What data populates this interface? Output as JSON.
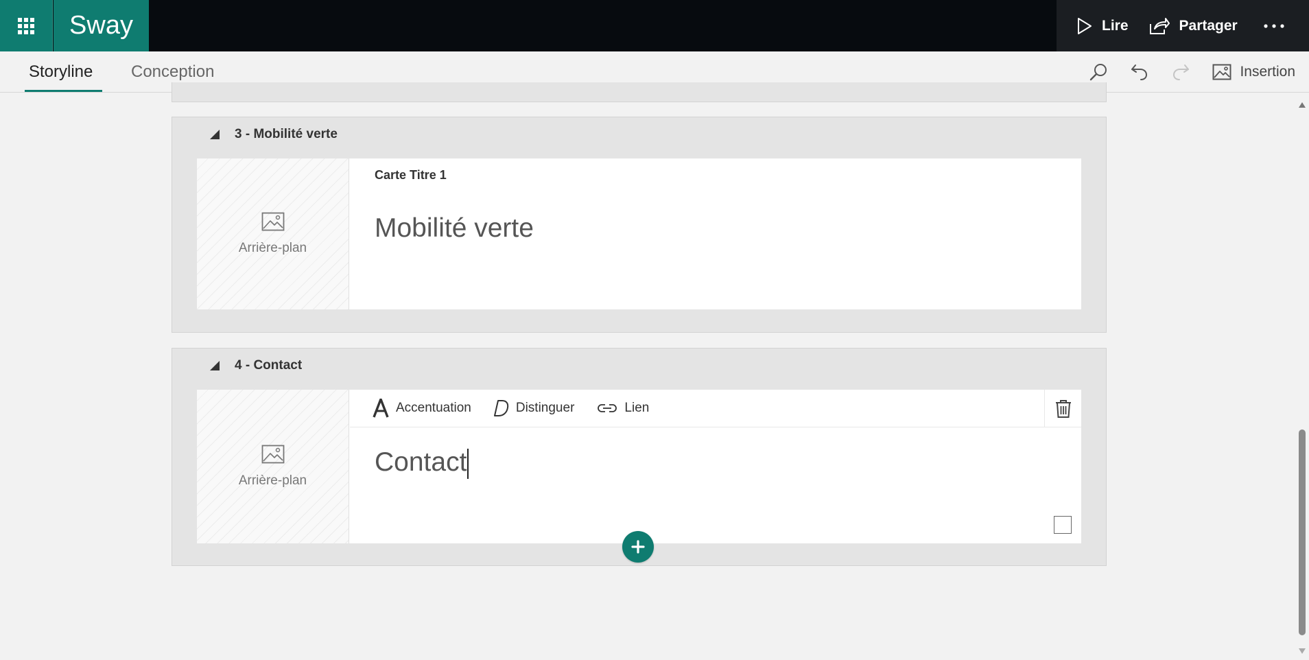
{
  "app": {
    "name": "Sway"
  },
  "topbar": {
    "play_label": "Lire",
    "share_label": "Partager",
    "icons": [
      "waffle-icon",
      "play-icon",
      "share-icon",
      "more-icon"
    ]
  },
  "tabs": [
    {
      "label": "Storyline",
      "active": true
    },
    {
      "label": "Conception",
      "active": false
    }
  ],
  "toolbar": {
    "insert_label": "Insertion",
    "icons": [
      "search-icon",
      "undo-icon",
      "redo-icon",
      "image-icon"
    ]
  },
  "sections": [
    {
      "heading": "3 - Mobilité verte",
      "card_label": "Carte Titre 1",
      "background_label": "Arrière-plan",
      "title": "Mobilité verte"
    },
    {
      "heading": "4 - Contact",
      "background_label": "Arrière-plan",
      "title": "Contact",
      "format_bar": {
        "accent_label": "Accentuation",
        "emphasis_label": "Distinguer",
        "link_label": "Lien"
      }
    }
  ],
  "colors": {
    "brand": "#0f7c70",
    "topbar": "#070b0f"
  }
}
